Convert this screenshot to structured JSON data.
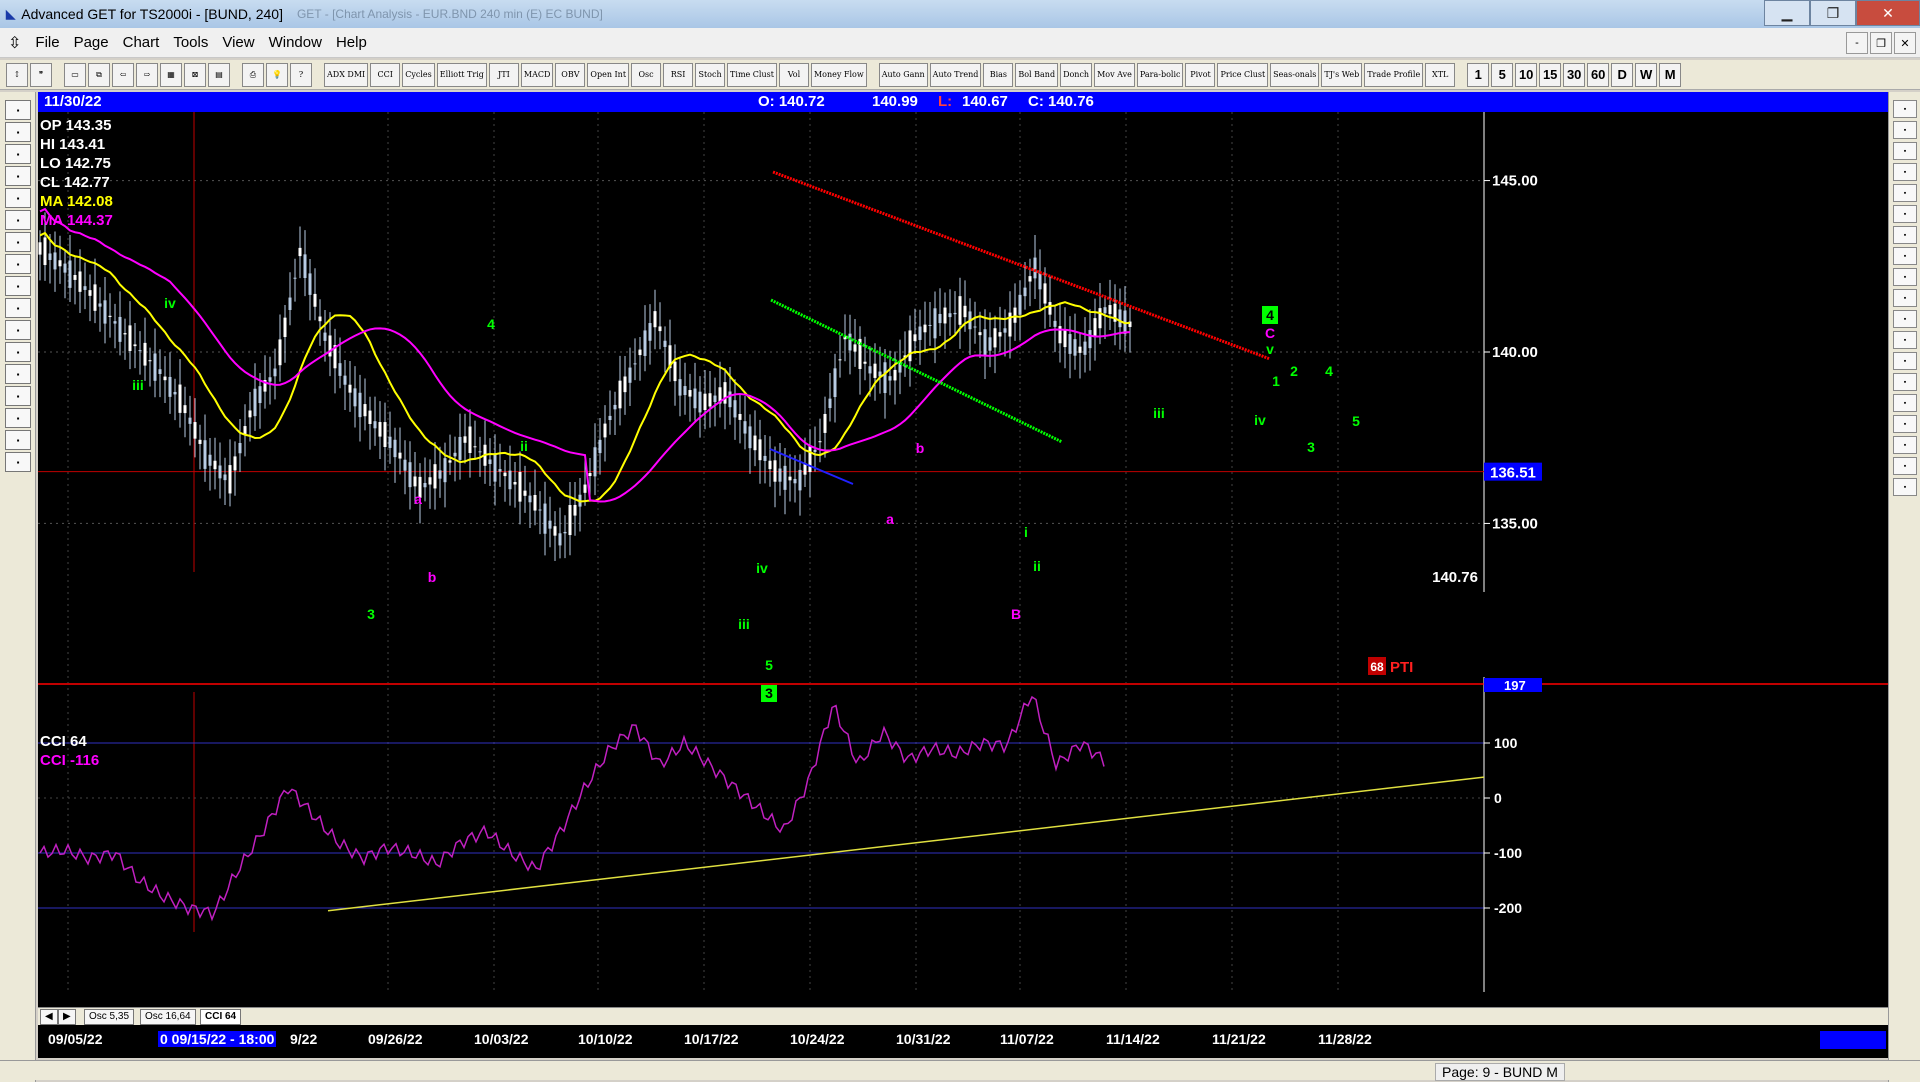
{
  "window": {
    "title": "Advanced GET for TS2000i - [BUND, 240]",
    "ghost_title": "GET - [Chart Analysis - EUR.BND 240 min (E) EC BUND]"
  },
  "menu": {
    "items": [
      "File",
      "Page",
      "Chart",
      "Tools",
      "View",
      "Window",
      "Help"
    ]
  },
  "toolbar": {
    "study_buttons": [
      "ADX DMI",
      "CCI",
      "Cycles",
      "Elliott Trig",
      "JTI",
      "MACD",
      "OBV",
      "Open Int",
      "Osc",
      "RSI",
      "Stoch",
      "Time Clust",
      "Vol",
      "Money Flow"
    ],
    "tool_buttons": [
      "Auto Gann",
      "Auto Trend",
      "Bias",
      "Bol Band",
      "Donch",
      "Mov Ave",
      "Para-bolic",
      "Pivot",
      "Price Clust",
      "Seas-onals",
      "TJ's Web",
      "Trade Profile",
      "XTL"
    ],
    "periods": [
      "1",
      "5",
      "10",
      "15",
      "30",
      "60",
      "D",
      "W",
      "M"
    ]
  },
  "infobar": {
    "date": "11/30/22",
    "open": "O: 140.72",
    "high": "140.99",
    "low_label": "L:",
    "low": "140.67",
    "close": "C: 140.76"
  },
  "legend": {
    "op": "OP  143.35",
    "hi": "HI   143.41",
    "lo": "LO   142.75",
    "cl": "CL   142.77",
    "ma1": "MA  142.08",
    "ma2": "MA  144.37"
  },
  "price_axis": {
    "labels": [
      "145.00",
      "140.00",
      "135.00"
    ],
    "cursor_price": "136.51",
    "last_price": "140.76"
  },
  "pti": {
    "value": "68",
    "label": "PTI"
  },
  "cci": {
    "title": "CCI 64",
    "value_label": "CCI  -116",
    "axis": [
      "100",
      "0",
      "-100",
      "-200"
    ],
    "top_value": "197"
  },
  "tabs": [
    "Osc 5,35",
    "Osc 16,64",
    "CCI 64"
  ],
  "dates": [
    "09/05/22",
    "09/26/22",
    "10/03/22",
    "10/10/22",
    "10/17/22",
    "10/24/22",
    "10/31/22",
    "11/07/22",
    "11/14/22",
    "11/21/22",
    "11/28/22"
  ],
  "cursor_date": "0 09/15/22 - 18:00",
  "cursor_date_tail": "9/22",
  "status": "Page: 9 - BUND M",
  "colors": {
    "bg": "#000000",
    "ma_fast": "#ffff00",
    "ma_slow": "#ff00ff",
    "elliott_green": "#00ff00",
    "elliott_magenta": "#ff00ff",
    "trend_red": "#ff0000",
    "trend_green": "#00ff00"
  },
  "chart_data": {
    "type": "line",
    "series": [],
    "y_price_range": [
      133.0,
      147.0
    ],
    "y_cci_range": [
      -220,
      200
    ],
    "price_close_path": [
      143.0,
      142.5,
      141.8,
      141.0,
      140.2,
      139.5,
      138.5,
      137.0,
      136.2,
      138.5,
      139.5,
      143.0,
      140.5,
      139.0,
      138.0,
      137.2,
      136.0,
      136.5,
      137.5,
      136.8,
      136.2,
      135.5,
      134.5,
      136.0,
      138.0,
      139.5,
      141.0,
      139.0,
      138.5,
      138.8,
      137.5,
      136.5,
      136.2,
      137.5,
      140.5,
      139.5,
      139.2,
      140.5,
      141.0,
      141.2,
      140.2,
      140.8,
      142.5,
      140.5,
      140.0,
      141.3,
      140.8
    ],
    "cci_path": [
      -100,
      -95,
      -110,
      -100,
      -150,
      -180,
      -200,
      -210,
      -130,
      -60,
      20,
      -30,
      -80,
      -110,
      -90,
      -100,
      -120,
      -80,
      -60,
      -100,
      -130,
      -60,
      20,
      90,
      130,
      60,
      100,
      60,
      20,
      -20,
      -60,
      30,
      170,
      60,
      120,
      70,
      90,
      80,
      100,
      95,
      190,
      60,
      100,
      65
    ]
  },
  "elliott_labels": [
    {
      "t": "iv",
      "c": "g"
    },
    {
      "t": "iii",
      "c": "g"
    },
    {
      "t": "4",
      "c": "g"
    },
    {
      "t": "ii",
      "c": "g"
    },
    {
      "t": "a",
      "c": "m"
    },
    {
      "t": "b",
      "c": "m"
    },
    {
      "t": "3",
      "c": "g"
    },
    {
      "t": "iv",
      "c": "g"
    },
    {
      "t": "iii",
      "c": "g"
    },
    {
      "t": "5",
      "c": "g"
    },
    {
      "t": "3",
      "c": "box"
    },
    {
      "t": "a",
      "c": "m"
    },
    {
      "t": "b",
      "c": "m"
    },
    {
      "t": "i",
      "c": "g"
    },
    {
      "t": "ii",
      "c": "g"
    },
    {
      "t": "B",
      "c": "m"
    },
    {
      "t": "iii",
      "c": "g"
    },
    {
      "t": "iv",
      "c": "g"
    },
    {
      "t": "4",
      "c": "box"
    },
    {
      "t": "C",
      "c": "m"
    },
    {
      "t": "v",
      "c": "g"
    },
    {
      "t": "1",
      "c": "g"
    },
    {
      "t": "2",
      "c": "g"
    },
    {
      "t": "3",
      "c": "g"
    },
    {
      "t": "4",
      "c": "g"
    },
    {
      "t": "5",
      "c": "g"
    }
  ]
}
